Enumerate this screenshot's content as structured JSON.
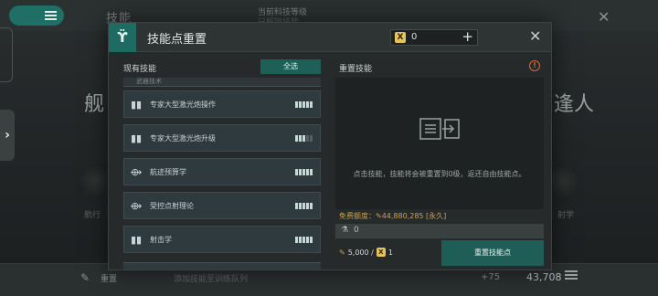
{
  "background": {
    "skill_title": "技能",
    "tech_level_label": "当前科技等级",
    "tech_level_sub": "已解锁技能",
    "big_left": "舰",
    "big_right": "逢人",
    "small_left": "航行",
    "small_right": "射学",
    "reset_label": "重置",
    "queue_label": "添加技能至训练队列",
    "count": "+75",
    "points": "43,708"
  },
  "dialog": {
    "title": "技能点重置",
    "currency_value": "0",
    "left": {
      "title": "现有技能",
      "select_all": "全选",
      "cut_group_label": "武器技术",
      "skills": [
        {
          "name": "专家大型激光炮操作",
          "icon": "bars-icon",
          "glyph": "▮▮",
          "level": 5,
          "max": 5
        },
        {
          "name": "专家大型激光炮升级",
          "icon": "bars-icon",
          "glyph": "▮▮",
          "level": 3,
          "max": 5
        },
        {
          "name": "航迹预算学",
          "icon": "trajectory-icon",
          "glyph": "⟴",
          "level": 5,
          "max": 5
        },
        {
          "name": "受控点射理论",
          "icon": "trajectory-icon",
          "glyph": "⟴",
          "level": 5,
          "max": 5
        },
        {
          "name": "射击学",
          "icon": "bars-icon",
          "glyph": "▮▮",
          "level": 5,
          "max": 5
        }
      ]
    },
    "right": {
      "title": "重置技能",
      "empty_text": "点击技能，技能将会被重置到0级，返还自由技能点。",
      "free_label": "免费额度：",
      "free_value": "44,880,285 [永久]",
      "input_value": "0",
      "cost_sp": "5,000 /",
      "cost_x": "1",
      "reset_button": "重置技能点"
    }
  }
}
